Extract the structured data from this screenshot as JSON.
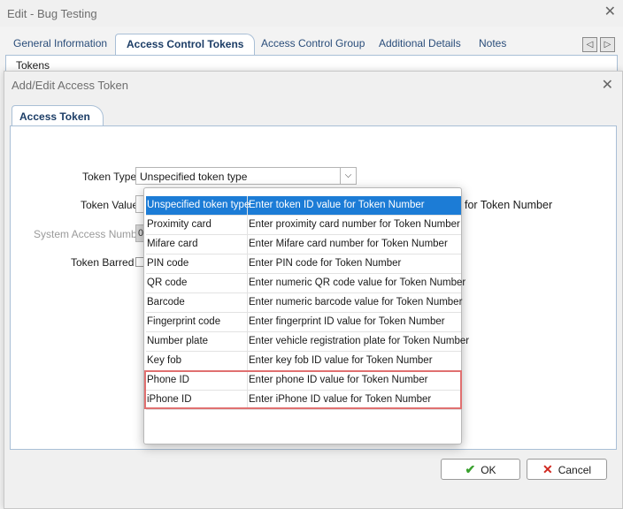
{
  "window": {
    "title": "Edit - Bug Testing"
  },
  "tabs": [
    {
      "label": "General Information"
    },
    {
      "label": "Access Control Tokens"
    },
    {
      "label": "Access Control Group"
    },
    {
      "label": "Additional Details"
    },
    {
      "label": "Notes"
    }
  ],
  "tokens_label": "Tokens",
  "dialog": {
    "title": "Add/Edit Access Token",
    "tab": "Access Token",
    "fields": {
      "token_type_label": "Token Type",
      "token_type_value": "Unspecified token type",
      "token_value_label": "Token Value",
      "system_access_number_label": "System Access Number",
      "system_access_number_value": "0",
      "token_barred_label": "Token Barred",
      "hint_text": "for Token Number"
    },
    "ok_label": "OK",
    "cancel_label": "Cancel"
  },
  "dropdown": {
    "options": [
      {
        "name": "Unspecified token type",
        "hint": "Enter token ID value for Token Number",
        "selected": true
      },
      {
        "name": "Proximity card",
        "hint": "Enter proximity card number for Token Number"
      },
      {
        "name": "Mifare card",
        "hint": "Enter Mifare card number for Token Number"
      },
      {
        "name": "PIN code",
        "hint": "Enter PIN code for Token Number"
      },
      {
        "name": "QR code",
        "hint": "Enter numeric QR code value for Token Number"
      },
      {
        "name": "Barcode",
        "hint": "Enter numeric barcode value for Token Number"
      },
      {
        "name": "Fingerprint code",
        "hint": "Enter fingerprint ID value for Token Number"
      },
      {
        "name": "Number plate",
        "hint": "Enter vehicle registration plate for Token Number"
      },
      {
        "name": "Key fob",
        "hint": "Enter key fob ID value for Token Number"
      },
      {
        "name": "Phone ID",
        "hint": "Enter phone ID value for Token Number",
        "highlighted": true
      },
      {
        "name": "iPhone ID",
        "hint": "Enter iPhone ID value for Token Number",
        "highlighted": true
      }
    ]
  },
  "colors": {
    "selection": "#1c7cd6",
    "highlight_border": "#e07070",
    "tab_text": "#1c3d66"
  }
}
